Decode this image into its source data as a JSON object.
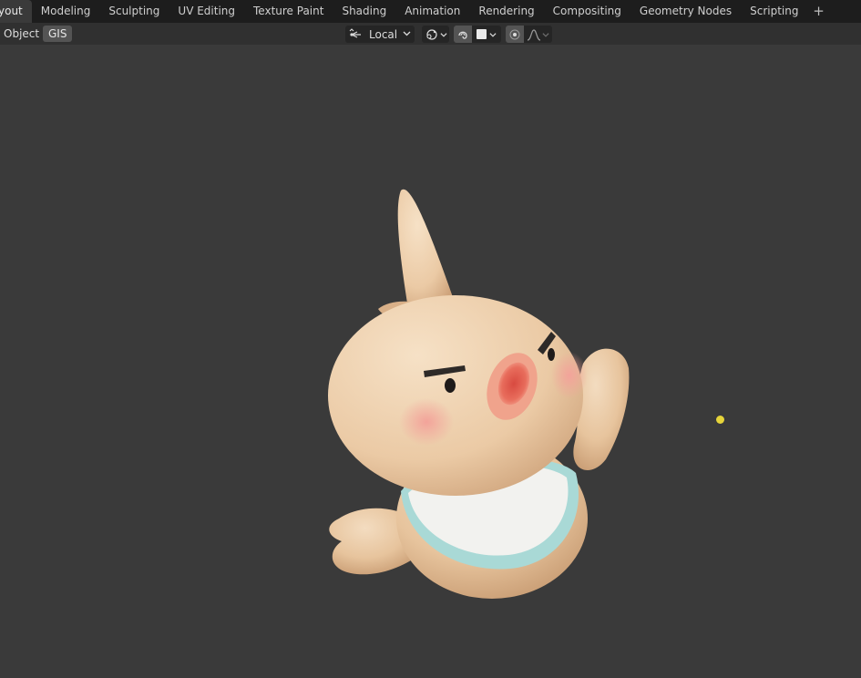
{
  "workspace_tabs": [
    {
      "label": "yout",
      "active": true
    },
    {
      "label": "Modeling"
    },
    {
      "label": "Sculpting"
    },
    {
      "label": "UV Editing"
    },
    {
      "label": "Texture Paint"
    },
    {
      "label": "Shading"
    },
    {
      "label": "Animation"
    },
    {
      "label": "Rendering"
    },
    {
      "label": "Compositing"
    },
    {
      "label": "Geometry Nodes"
    },
    {
      "label": "Scripting"
    }
  ],
  "add_workspace_glyph": "+",
  "header": {
    "object_menu": "Object",
    "gis_menu": "GIS",
    "transform_orientation": "Local",
    "snap_target_color": "#eaeaea"
  },
  "icons": {
    "orientation": "transform-orientation-icon",
    "pivot": "pivot-point-icon",
    "snap": "snap-magnet-icon",
    "proportional": "proportional-editing-icon",
    "falloff": "falloff-curve-icon"
  },
  "viewport": {
    "background": "#3a3a3a",
    "light_color": "#e6d43a",
    "object": "mascot-3d-model"
  }
}
